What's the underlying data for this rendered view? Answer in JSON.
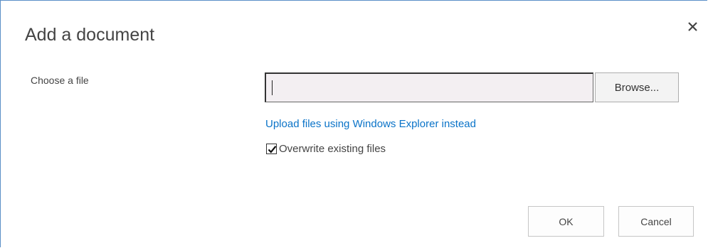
{
  "dialog": {
    "title": "Add a document",
    "close_icon": "close-icon"
  },
  "file_field": {
    "label": "Choose a file",
    "value": "",
    "browse_label": "Browse..."
  },
  "upload_link": "Upload files using Windows Explorer instead",
  "overwrite": {
    "label": "Overwrite existing files",
    "checked": true
  },
  "buttons": {
    "ok": "OK",
    "cancel": "Cancel"
  },
  "colors": {
    "link": "#0a73c8",
    "border_accent": "#5b8fc7",
    "input_bg": "#f3eff2"
  }
}
